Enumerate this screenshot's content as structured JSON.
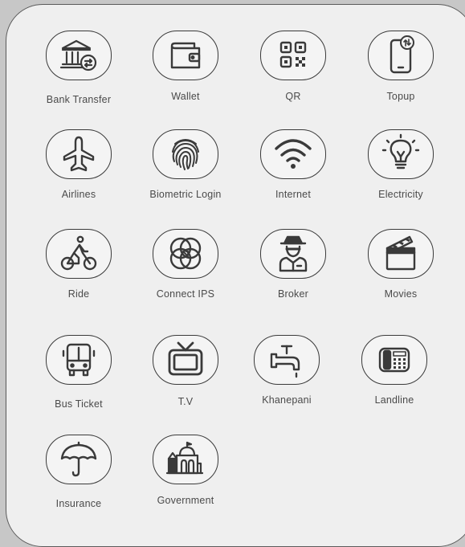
{
  "services": [
    {
      "id": "bank-transfer",
      "label": "Bank Transfer",
      "icon": "bank-transfer-icon"
    },
    {
      "id": "wallet",
      "label": "Wallet",
      "icon": "wallet-icon"
    },
    {
      "id": "qr",
      "label": "QR",
      "icon": "qr-code-icon"
    },
    {
      "id": "topup",
      "label": "Topup",
      "icon": "mobile-topup-icon"
    },
    {
      "id": "airlines",
      "label": "Airlines",
      "icon": "airplane-icon"
    },
    {
      "id": "biometric-login",
      "label": "Biometric Login",
      "icon": "fingerprint-icon"
    },
    {
      "id": "internet",
      "label": "Internet",
      "icon": "wifi-icon"
    },
    {
      "id": "electricity",
      "label": "Electricity",
      "icon": "lightbulb-icon"
    },
    {
      "id": "ride",
      "label": "Ride",
      "icon": "cyclist-icon"
    },
    {
      "id": "connect-ips",
      "label": "Connect IPS",
      "icon": "connect-ips-icon"
    },
    {
      "id": "broker",
      "label": "Broker",
      "icon": "broker-person-icon"
    },
    {
      "id": "movies",
      "label": "Movies",
      "icon": "clapperboard-icon"
    },
    {
      "id": "bus-ticket",
      "label": "Bus Ticket",
      "icon": "bus-icon"
    },
    {
      "id": "tv",
      "label": "T.V",
      "icon": "television-icon"
    },
    {
      "id": "khanepani",
      "label": "Khanepani",
      "icon": "water-tap-icon"
    },
    {
      "id": "landline",
      "label": "Landline",
      "icon": "telephone-icon"
    },
    {
      "id": "insurance",
      "label": "Insurance",
      "icon": "umbrella-icon"
    },
    {
      "id": "government",
      "label": "Government",
      "icon": "government-building-icon"
    }
  ]
}
